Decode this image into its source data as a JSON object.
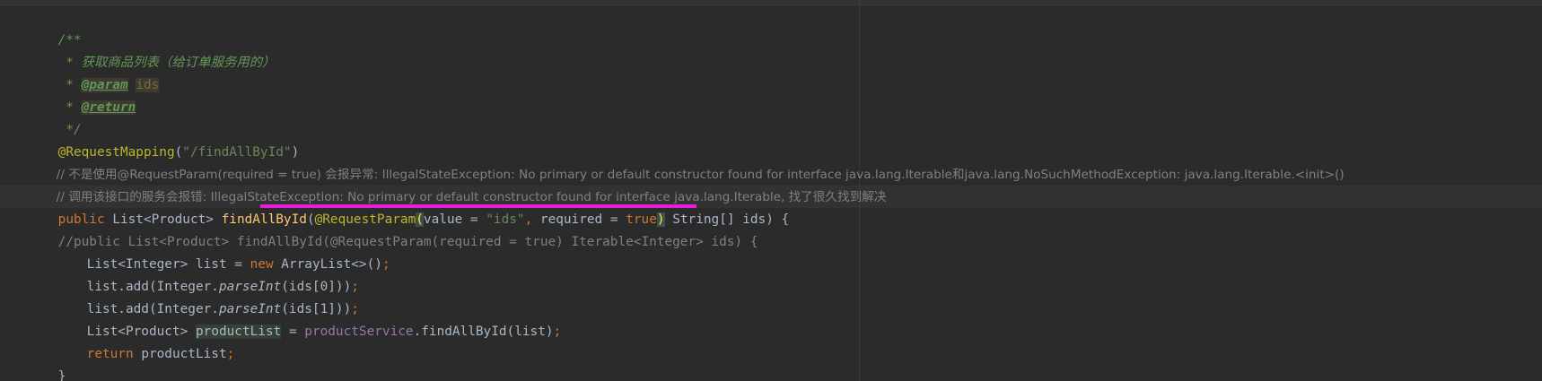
{
  "code": {
    "doc_open": "/**",
    "doc_line_prefix": " * ",
    "doc_desc": "获取商品列表（给订单服务用的）",
    "doc_param_tag": "@param",
    "doc_param_name": "ids",
    "doc_return_tag": "@return",
    "doc_close": " */",
    "mapping_ann": "@RequestMapping",
    "mapping_open": "(",
    "mapping_str": "\"/findAllById\"",
    "mapping_close": ")",
    "comment1": "// 不是使用@RequestParam(required = true) 会报异常: IllegalStateException: No primary or default constructor found for interface java.lang.Iterable和java.lang.NoSuchMethodException: java.lang.Iterable.<init>()",
    "comment2": "// 调用该接口的服务会报错: IllegalStateException: No primary or default constructor found for interface java.lang.Iterable, 找了很久找到解决",
    "sig_public": "public",
    "sig_type": "List<Product>",
    "sig_method": "findAllById",
    "sig_paren_open": "(",
    "sig_ann": "@RequestParam",
    "sig_ann_paren_open": "(",
    "sig_value_key": "value",
    "sig_eq1": " = ",
    "sig_value_str": "\"ids\"",
    "sig_comma": ", ",
    "sig_required_key": "required",
    "sig_eq2": " = ",
    "sig_true": "true",
    "sig_ann_paren_close": ")",
    "sig_param_type": "String[]",
    "sig_param_name": "ids",
    "sig_paren_close": ")",
    "sig_brace": "{",
    "commented_sig": "//public List<Product> findAllById(@RequestParam(required = true) Iterable<Integer> ids) {",
    "l1_type": "List<Integer>",
    "l1_var": "list",
    "l1_eq": " = ",
    "l1_new": "new",
    "l1_rest": "ArrayList<>()",
    "semi": ";",
    "l2_a": "list.add(Integer.",
    "l2_parse": "parseInt",
    "l2_b": "(ids[0]))",
    "l3_a": "list.add(Integer.",
    "l3_parse": "parseInt",
    "l3_b": "(ids[1]))",
    "l4_type": "List<Product>",
    "l4_var": "productList",
    "l4_eq": " = ",
    "l4_field": "productService",
    "l4_call": ".findAllById(list)",
    "l5_return": "return",
    "l5_var": "productList",
    "close_brace": "}"
  },
  "colors": {
    "background": "#2b2b2b",
    "keyword": "#cc7832",
    "annotation": "#bbb529",
    "string": "#6a8759",
    "method": "#ffc66d",
    "field": "#9876aa",
    "comment": "#808080",
    "doc": "#629755",
    "underline_marker": "#e81ddb"
  }
}
